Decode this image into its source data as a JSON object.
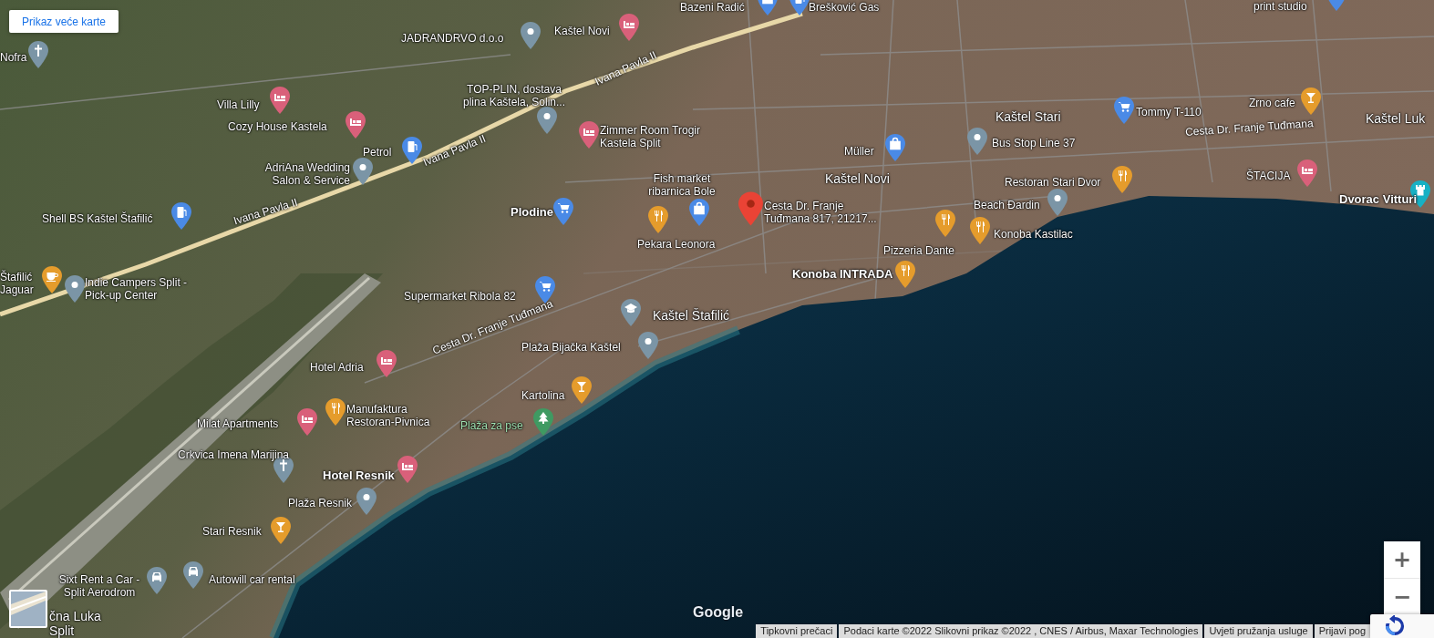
{
  "map_button": {
    "label": "Prikaz veće karte"
  },
  "towns": [
    {
      "label": "Kaštel Stari"
    },
    {
      "label": "Kaštel Novi"
    },
    {
      "label": "Kaštel Štafilić"
    },
    {
      "label": "Kaštel Luk"
    },
    {
      "label": "čna Luka Split"
    }
  ],
  "roads": [
    {
      "label": "Ivana Pavla II"
    },
    {
      "label": "Ivana Pavla II"
    },
    {
      "label": "Ivana Pavla II"
    },
    {
      "label": "Cesta Dr. Franje Tuđmana"
    },
    {
      "label": "Cesta Dr. Franje Tuđmana"
    }
  ],
  "places": [
    {
      "label": "Bazeni Radić",
      "kind": "shop",
      "color": "#4a8ae6",
      "prominent": false
    },
    {
      "label": "Brešković Gas",
      "kind": "gas",
      "color": "#4a8ae6",
      "prominent": false
    },
    {
      "label": "print studio",
      "kind": "shop",
      "color": "#4a8ae6",
      "prominent": false
    },
    {
      "label": "JADRANDRVO d.o.o",
      "kind": "generic",
      "color": "#7b95a6",
      "prominent": false
    },
    {
      "label": "Kaštel Novi",
      "kind": "hotel",
      "color": "#d9607a",
      "prominent": false
    },
    {
      "label": "Nofra",
      "kind": "church",
      "color": "#7b95a6",
      "prominent": false
    },
    {
      "label": "Villa Lilly",
      "kind": "hotel",
      "color": "#d9607a",
      "prominent": false
    },
    {
      "label": "Cozy House Kastela",
      "kind": "hotel",
      "color": "#d9607a",
      "prominent": false
    },
    {
      "label": "TOP-PLIN, dostava plina Kaštela, Solin...",
      "kind": "generic",
      "color": "#7b95a6",
      "prominent": false
    },
    {
      "label": "Zimmer Room Trogir Kastela Split",
      "kind": "hotel",
      "color": "#d9607a",
      "prominent": false
    },
    {
      "label": "Petrol",
      "kind": "gas",
      "color": "#4a8ae6",
      "prominent": false
    },
    {
      "label": "AdriAna Wedding Salon & Service",
      "kind": "generic",
      "color": "#7b95a6",
      "prominent": false
    },
    {
      "label": "Shell BS Kaštel Štafilić",
      "kind": "gas",
      "color": "#4a8ae6",
      "prominent": false
    },
    {
      "label": "Plodine",
      "kind": "cart",
      "color": "#4a8ae6",
      "prominent": true
    },
    {
      "label": "Fish market ribarnica Bole",
      "kind": "shop",
      "color": "#4a8ae6",
      "prominent": false
    },
    {
      "label": "Pekara Leonora",
      "kind": "restaurant",
      "color": "#e59c2c",
      "prominent": false
    },
    {
      "label": "Müller",
      "kind": "shop",
      "color": "#4a8ae6",
      "prominent": false
    },
    {
      "label": "Bus Stop Line 37",
      "kind": "generic",
      "color": "#7b95a6",
      "prominent": false
    },
    {
      "label": "Tommy T-110",
      "kind": "cart",
      "color": "#4a8ae6",
      "prominent": false
    },
    {
      "label": "Zrno cafe",
      "kind": "bar",
      "color": "#e59c2c",
      "prominent": false
    },
    {
      "label": "Restoran Stari Dvor",
      "kind": "restaurant",
      "color": "#e59c2c",
      "prominent": false
    },
    {
      "label": "Beach Đardin",
      "kind": "generic",
      "color": "#7b95a6",
      "prominent": false
    },
    {
      "label": "Konoba Kastilac",
      "kind": "restaurant",
      "color": "#e59c2c",
      "prominent": false
    },
    {
      "label": "Pizzeria Dante",
      "kind": "restaurant",
      "color": "#e59c2c",
      "prominent": false
    },
    {
      "label": "Konoba INTRADA",
      "kind": "restaurant",
      "color": "#e59c2c",
      "prominent": true
    },
    {
      "label": "ŠTACIJA",
      "kind": "hotel",
      "color": "#d9607a",
      "prominent": false
    },
    {
      "label": "Dvorac Vitturi",
      "kind": "castle",
      "color": "#17b1c4",
      "prominent": true
    },
    {
      "label": "Štafilić Jaguar",
      "kind": "cafe",
      "color": "#e59c2c",
      "prominent": false
    },
    {
      "label": "Indie Campers Split - Pick-up Center",
      "kind": "generic",
      "color": "#7b95a6",
      "prominent": false
    },
    {
      "label": "Supermarket Ribola 82",
      "kind": "cart",
      "color": "#4a8ae6",
      "prominent": false
    },
    {
      "kind": "school",
      "color": "#7b95a6"
    },
    {
      "label": "Plaža Bijačka Kaštel",
      "kind": "generic",
      "color": "#7b95a6",
      "prominent": false
    },
    {
      "label": "Hotel Adria",
      "kind": "hotel",
      "color": "#d9607a",
      "prominent": false
    },
    {
      "label": "Kartolina",
      "kind": "bar",
      "color": "#e59c2c",
      "prominent": false
    },
    {
      "label": "Manufaktura Restoran-Pivnica",
      "kind": "restaurant",
      "color": "#e59c2c",
      "prominent": false
    },
    {
      "label": "Milat Apartments",
      "kind": "hotel",
      "color": "#d9607a",
      "prominent": false
    },
    {
      "label": "Plaža za pse",
      "kind": "park",
      "color": "#3f9a62",
      "prominent": false
    },
    {
      "label": "Crkvica Imena Marijina",
      "kind": "church",
      "color": "#7b95a6",
      "prominent": false
    },
    {
      "label": "Hotel Resnik",
      "kind": "hotel",
      "color": "#d9607a",
      "prominent": true
    },
    {
      "label": "Plaža Resnik",
      "kind": "generic",
      "color": "#7b95a6",
      "prominent": false
    },
    {
      "label": "Stari Resnik",
      "kind": "bar",
      "color": "#e59c2c",
      "prominent": false
    },
    {
      "label": "Sixt Rent a Car - Split Aerodrom",
      "kind": "car",
      "color": "#7b95a6",
      "prominent": false
    },
    {
      "label": "Autowill car rental",
      "kind": "car",
      "color": "#7b95a6",
      "prominent": false
    }
  ],
  "main_marker": {
    "label": "Cesta Dr. Franje Tuđmana 817, 21217..."
  },
  "zoom_controls": [
    {
      "label": "+"
    },
    {
      "label": "−"
    }
  ],
  "logo": "Google",
  "footer": [
    "Tipkovni prečaci",
    "Podaci karte ©2022 Slikovni prikaz ©2022 , CNES / Airbus, Maxar Technologies",
    "Uvjeti pružanja usluge",
    "Prijavi pog"
  ]
}
